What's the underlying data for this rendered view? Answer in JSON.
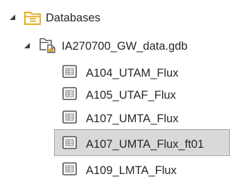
{
  "tree": {
    "root": {
      "label": "Databases",
      "expanded": true,
      "icon": "database-folder-icon"
    },
    "geodatabase": {
      "label": "IA270700_GW_data.gdb",
      "expanded": true,
      "icon": "file-geodatabase-icon"
    },
    "tables": [
      {
        "label": "A104_UTAM_Flux",
        "icon": "table-icon",
        "selected": false
      },
      {
        "label": "A105_UTAF_Flux",
        "icon": "table-icon",
        "selected": false
      },
      {
        "label": "A107_UMTA_Flux",
        "icon": "table-icon",
        "selected": false
      },
      {
        "label": "A107_UMTA_Flux_ft01",
        "icon": "table-icon",
        "selected": true
      },
      {
        "label": "A109_LMTA_Flux",
        "icon": "table-icon",
        "selected": false
      }
    ]
  },
  "colors": {
    "selection_background": "#d9d9d9",
    "selection_border": "#a6a6a6",
    "folder_gold": "#e8a91d",
    "text": "#262626"
  }
}
